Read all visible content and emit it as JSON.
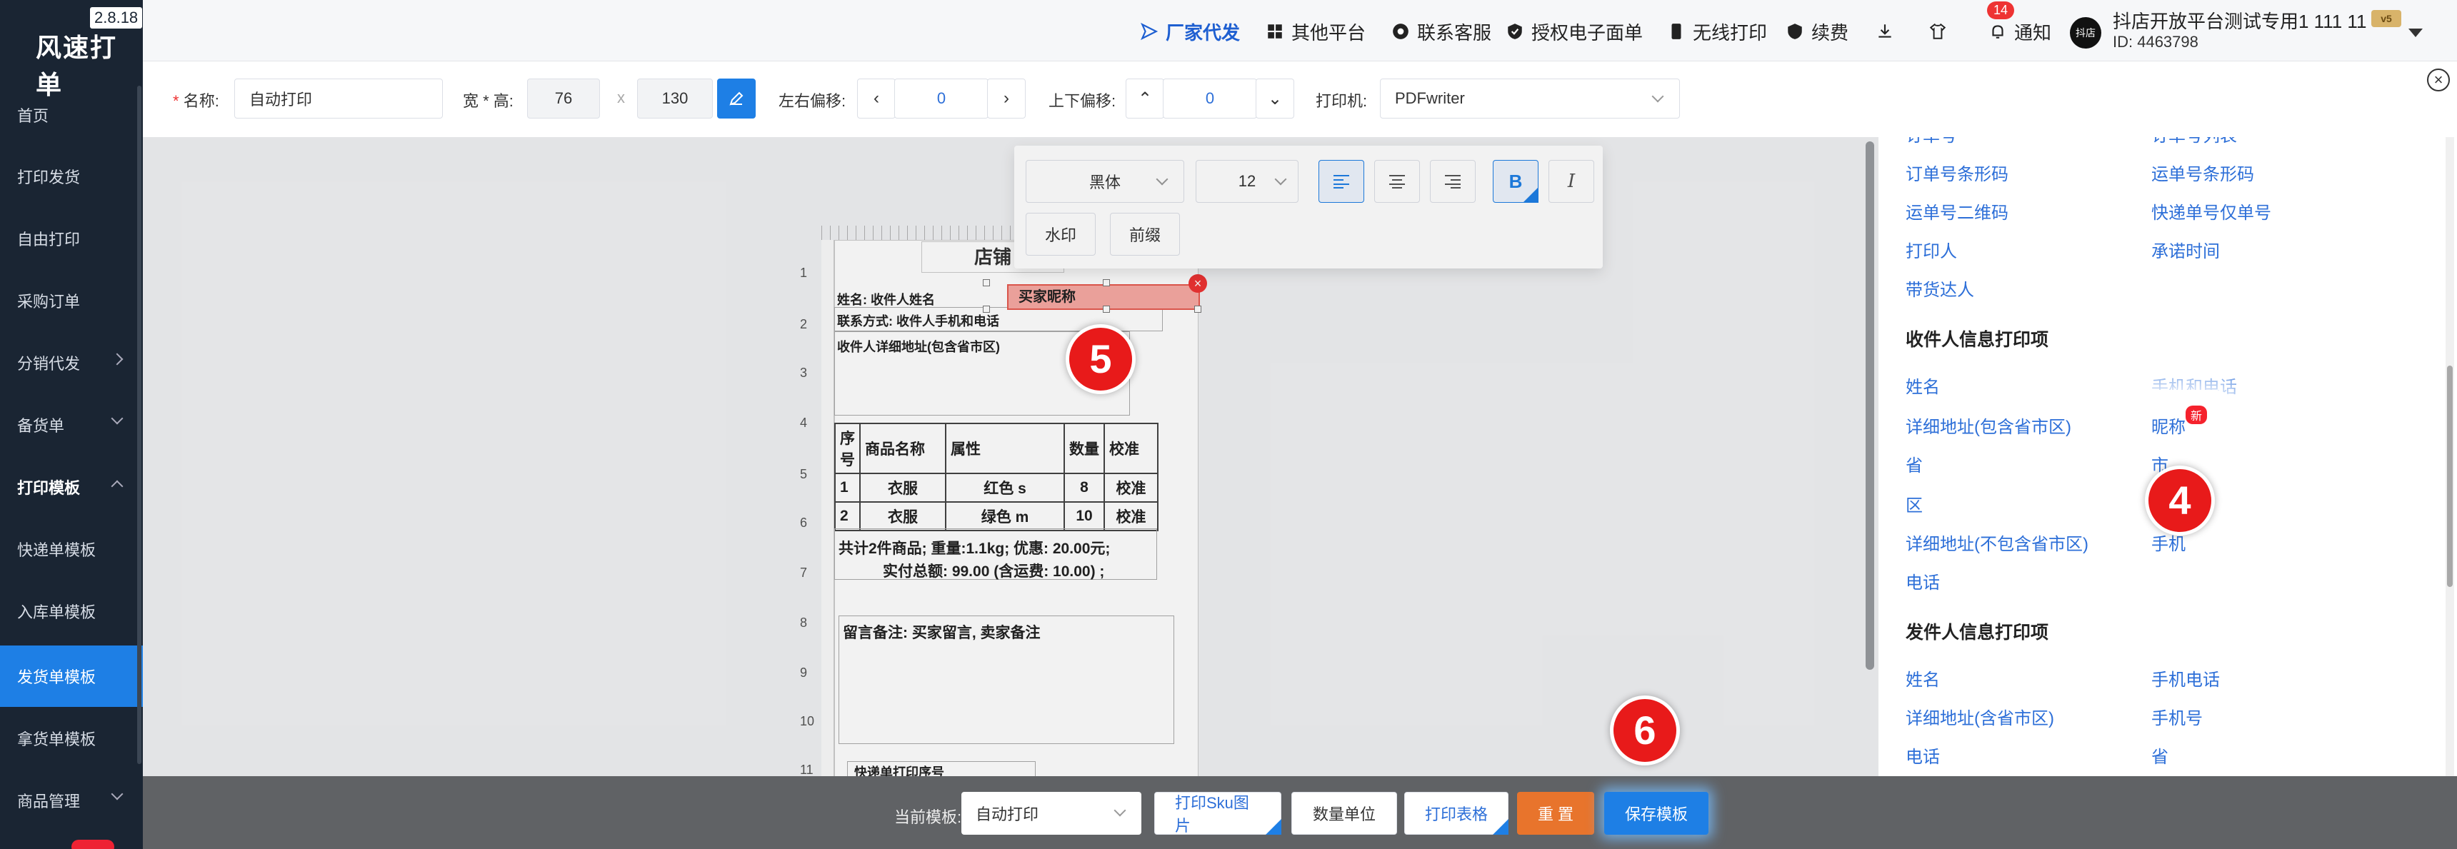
{
  "app": {
    "name": "风速打单",
    "version": "2.8.18"
  },
  "sidebar": {
    "items": [
      {
        "label": "首页"
      },
      {
        "label": "打印发货"
      },
      {
        "label": "自由打印"
      },
      {
        "label": "采购订单"
      },
      {
        "label": "分销代发"
      },
      {
        "label": "备货单"
      },
      {
        "label": "打印模板"
      },
      {
        "label": "快递单模板"
      },
      {
        "label": "入库单模板"
      },
      {
        "label": "发货单模板"
      },
      {
        "label": "拿货单模板"
      },
      {
        "label": "商品管理"
      }
    ]
  },
  "topbar": {
    "items": [
      "厂家代发",
      "其他平台",
      "联系客服",
      "授权电子面单",
      "无线打印",
      "续费"
    ],
    "notice_label": "通知",
    "notice_count": "14",
    "avatar_text": "抖店",
    "account_name": "抖店开放平台测试专用1 111 11",
    "account_id": "ID:  4463798",
    "vip": "v5"
  },
  "toolbar": {
    "name_label": "名称:",
    "name_value": "自动打印",
    "size_label": "宽 * 高:",
    "width": "76",
    "times": "x",
    "height": "130",
    "h_offset_label": "左右偏移:",
    "h_offset": "0",
    "v_offset_label": "上下偏移:",
    "v_offset": "0",
    "printer_label": "打印机:",
    "printer": "PDFwriter"
  },
  "font_popup": {
    "font": "黑体",
    "size": "12",
    "watermark": "水印",
    "prefix": "前缀"
  },
  "paper": {
    "shop": "店铺",
    "name_line": "姓名: 收件人姓名",
    "contact_line": "联系方式: 收件人手机和电话",
    "address_line": "收件人详细地址(包含省市区)",
    "selected_field": "买家昵称",
    "table_headers": [
      "序号",
      "商品名称",
      "属性",
      "数量",
      "校准"
    ],
    "table_rows": [
      [
        "1",
        "衣服",
        "红色 s",
        "8",
        "校准"
      ],
      [
        "2",
        "衣服",
        "绿色 m",
        "10",
        "校准"
      ]
    ],
    "summary1": "共计2件商品; 重量:1.1kg; 优惠: 20.00元;",
    "summary2": "实付总额: 99.00 (含运费: 10.00) ;",
    "remark": "留言备注: 买家留言, 卖家备注",
    "express_seq": "快递单打印序号",
    "ruler": [
      "1",
      "2",
      "3",
      "4",
      "5",
      "6",
      "7",
      "8",
      "9",
      "10",
      "11"
    ]
  },
  "right_panel": {
    "top_partial": [
      "订单号",
      "订单号列表"
    ],
    "order_links": [
      "订单号条形码",
      "运单号条形码",
      "运单号二维码",
      "快递单号仅单号",
      "打印人",
      "承诺时间",
      "带货达人"
    ],
    "recv_head": "收件人信息打印项",
    "recv_links": [
      "姓名",
      "手机和电话",
      "详细地址(包含省市区)",
      "昵称",
      "省",
      "市",
      "区",
      "详细地址(不包含省市区)",
      "手机",
      "电话"
    ],
    "new_badge": "新",
    "send_head": "发件人信息打印项",
    "send_links": [
      "姓名",
      "手机电话",
      "详细地址(含省市区)",
      "手机号",
      "电话",
      "省"
    ]
  },
  "bottom": {
    "template_label": "当前模板:",
    "template_value": "自动打印",
    "sku_img": "打印Sku图片",
    "qty_unit": "数量单位",
    "print_table": "打印表格",
    "reset": "重 置",
    "save": "保存模板"
  },
  "markers": {
    "m4": "4",
    "m5": "5",
    "m6": "6"
  }
}
